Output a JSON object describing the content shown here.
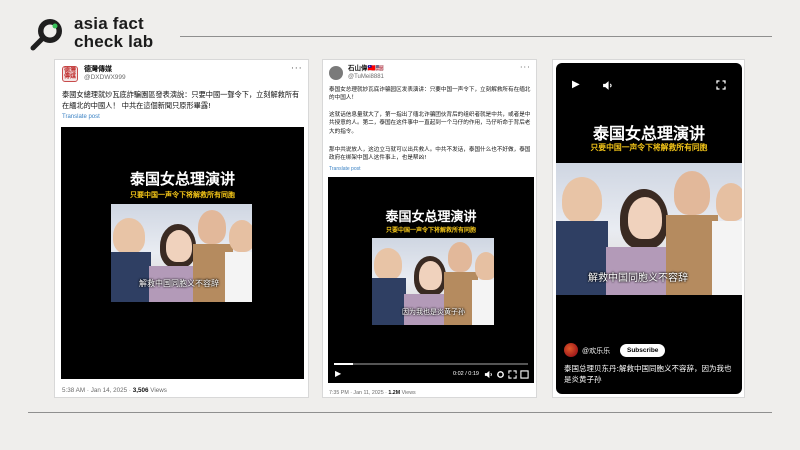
{
  "brand": {
    "name_line1": "asia fact",
    "name_line2": "check lab"
  },
  "post1": {
    "avatar_text": "德灣傳媒",
    "username": "德灣傳媒",
    "handle": "@DXDWX999",
    "text": "泰國女總理就炒瓦底詐騙園區發表演說：只要中國一聲令下，立刻解救所有在緬北的中國人！ 中共在這個新聞只原形畢露!",
    "translate": "Translate post",
    "video": {
      "title": "泰国女总理演讲",
      "subtitle": "只要中国一声令下将解救所有同胞",
      "caption": "解救中国同胞义不容辞"
    },
    "meta": {
      "time": "5:38 AM · Jan 14, 2025 · ",
      "views_count": "3,506",
      "views_label": " Views"
    }
  },
  "post2": {
    "username": "石山偉🇹🇼🇺🇸",
    "handle": "@TuMei8881",
    "text1": "泰国女总理就妙瓦底诈骗园区发表演讲：只要中国一声令下，立刻解救所有在缅北的中国人！",
    "text2": "这就话信息量就大了，第一指出了缅北诈骗团伙背后的组织者就是中共，或者是中共授意的人。第二，泰国在这件事中一直起到一个马仔的作用，马仔听命于背后老大的指令。",
    "text3": "那中共说放人，这边立马就可以出兵救人。中共不发话，泰国什么也不好做，泰国政府在绑架中国人这件事上，也是帮凶!",
    "translate": "Translate post",
    "video": {
      "title": "泰国女总理演讲",
      "subtitle": "只要中国一声令下将解救所有同胞",
      "caption": "因为我也是炎黄子孙",
      "time": "0:02 / 0:19"
    },
    "progress": 0.1,
    "meta": {
      "time": "7:35 PM · Jan 11, 2025 · ",
      "views_count": "1.2M",
      "views_label": " Views"
    }
  },
  "post3": {
    "video": {
      "title": "泰国女总理演讲",
      "subtitle": "只要中国一声令下将解救所有同胞",
      "caption": "解救中国同胞义不容辞"
    },
    "channel": "@欢乐乐",
    "subscribe": "Subscribe",
    "title": "泰国总理贝东丹:解救中国同胞义不容辞，因为我也是炎黄子孙"
  }
}
